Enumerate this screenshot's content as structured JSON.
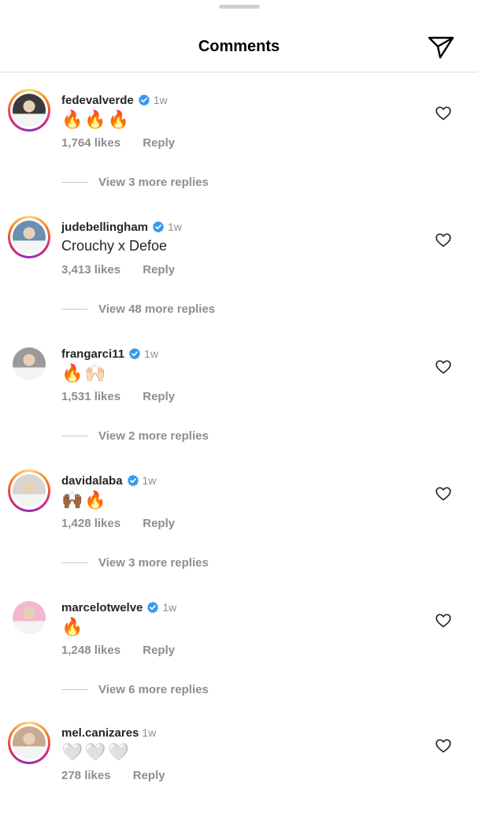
{
  "header": {
    "title": "Comments",
    "send_icon": "paper-plane-icon"
  },
  "comments": [
    {
      "username": "fedevalverde",
      "verified": true,
      "time": "1w",
      "text": "🔥🔥🔥",
      "likes": "1,764 likes",
      "reply": "Reply",
      "view_replies": "View 3 more replies",
      "avatar_bg": "#3a3a3a",
      "ring": true
    },
    {
      "username": "judebellingham",
      "verified": true,
      "time": "1w",
      "text": "Crouchy x Defoe",
      "likes": "3,413 likes",
      "reply": "Reply",
      "view_replies": "View 48 more replies",
      "avatar_bg": "#6b8fb0",
      "ring": true
    },
    {
      "username": "frangarci11",
      "verified": true,
      "time": "1w",
      "text": "🔥🙌🏻",
      "likes": "1,531 likes",
      "reply": "Reply",
      "view_replies": "View 2 more replies",
      "avatar_bg": "#9a9a9a",
      "ring": false
    },
    {
      "username": "davidalaba",
      "verified": true,
      "time": "1w",
      "text": "🙌🏾🔥",
      "likes": "1,428 likes",
      "reply": "Reply",
      "view_replies": "View 3 more replies",
      "avatar_bg": "#d8d4cf",
      "ring": true
    },
    {
      "username": "marcelotwelve",
      "verified": true,
      "time": "1w",
      "text": "🔥",
      "likes": "1,248 likes",
      "reply": "Reply",
      "view_replies": "View 6 more replies",
      "avatar_bg": "#f2b8cf",
      "ring": false
    },
    {
      "username": "mel.canizares",
      "verified": false,
      "time": "1w",
      "text": "🤍🤍🤍",
      "likes": "278 likes",
      "reply": "Reply",
      "view_replies": "",
      "avatar_bg": "#c9a98e",
      "ring": true
    }
  ],
  "colors": {
    "verified": "#3897f0",
    "muted": "#8e8e8e",
    "text": "#262626"
  },
  "icons": {
    "verified": "verified-badge-icon",
    "like": "heart-icon"
  }
}
